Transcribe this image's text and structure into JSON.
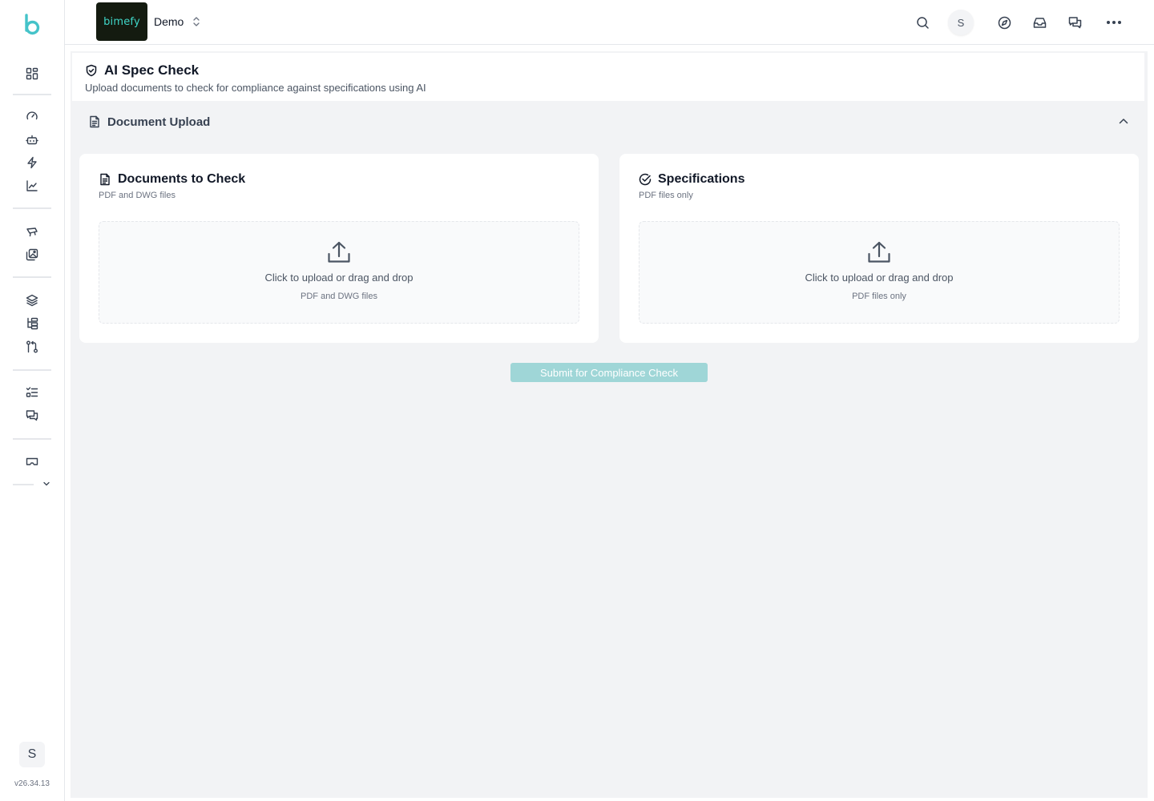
{
  "app": {
    "brand_text": "bimefy",
    "workspace_name": "Demo",
    "user_initial": "S",
    "version": "v26.34.13"
  },
  "sidebar": {
    "icons": [
      "dashboard-icon",
      "gauge-icon",
      "bot-icon",
      "lightning-icon",
      "line-chart-icon",
      "drone-icon",
      "images-icon",
      "layers-icon",
      "hierarchy-icon",
      "git-compare-icon",
      "checklist-icon",
      "messages-icon",
      "vr-headset-icon",
      "chevron-down-icon"
    ]
  },
  "topbar": {
    "icons": [
      "search-icon",
      "compass-icon",
      "inbox-icon",
      "chat-icon",
      "more-icon"
    ]
  },
  "page": {
    "title": "AI Spec Check",
    "subtitle": "Upload documents to check for compliance against specifications using AI"
  },
  "section": {
    "title": "Document Upload"
  },
  "documents_card": {
    "title": "Documents to Check",
    "subtitle": "PDF and DWG files",
    "dropzone_text": "Click to upload or drag and drop",
    "dropzone_hint": "PDF and DWG files"
  },
  "specs_card": {
    "title": "Specifications",
    "subtitle": "PDF files only",
    "dropzone_text": "Click to upload or drag and drop",
    "dropzone_hint": "PDF files only"
  },
  "actions": {
    "submit_label": "Submit for Compliance Check"
  },
  "colors": {
    "brand_teal": "#3fd6c8",
    "submit_disabled": "#9fd6d7",
    "content_bg": "#f2f3f5"
  }
}
